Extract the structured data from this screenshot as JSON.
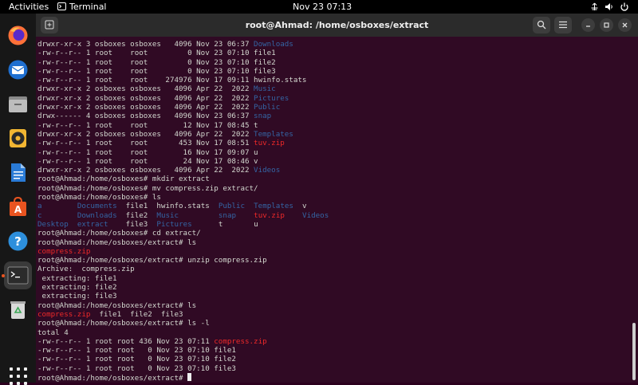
{
  "topbar": {
    "activities": "Activities",
    "app_name": "Terminal",
    "clock": "Nov 23  07:13"
  },
  "dock": {
    "items": [
      {
        "name": "firefox-icon"
      },
      {
        "name": "thunderbird-icon"
      },
      {
        "name": "files-icon"
      },
      {
        "name": "rhythmbox-icon"
      },
      {
        "name": "writer-icon"
      },
      {
        "name": "software-icon"
      },
      {
        "name": "help-icon"
      },
      {
        "name": "terminal-icon"
      },
      {
        "name": "trash-icon"
      },
      {
        "name": "show-apps-icon"
      }
    ]
  },
  "window": {
    "title": "root@Ahmad: /home/osboxes/extract"
  },
  "terminal": {
    "lines": [
      [
        {
          "t": "drwxr-xr-x 3 osboxes osboxes   4096 Nov 23 06:37 "
        },
        {
          "t": "Downloads",
          "c": "blue"
        }
      ],
      [
        {
          "t": "-rw-r--r-- 1 root    root         0 Nov 23 07:10 file1"
        }
      ],
      [
        {
          "t": "-rw-r--r-- 1 root    root         0 Nov 23 07:10 file2"
        }
      ],
      [
        {
          "t": "-rw-r--r-- 1 root    root         0 Nov 23 07:10 file3"
        }
      ],
      [
        {
          "t": "-rw-r--r-- 1 root    root    274976 Nov 17 09:11 hwinfo.stats"
        }
      ],
      [
        {
          "t": "drwxr-xr-x 2 osboxes osboxes   4096 Apr 22  2022 "
        },
        {
          "t": "Music",
          "c": "blue"
        }
      ],
      [
        {
          "t": "drwxr-xr-x 2 osboxes osboxes   4096 Apr 22  2022 "
        },
        {
          "t": "Pictures",
          "c": "blue"
        }
      ],
      [
        {
          "t": "drwxr-xr-x 2 osboxes osboxes   4096 Apr 22  2022 "
        },
        {
          "t": "Public",
          "c": "blue"
        }
      ],
      [
        {
          "t": "drwx------ 4 osboxes osboxes   4096 Nov 23 06:37 "
        },
        {
          "t": "snap",
          "c": "blue"
        }
      ],
      [
        {
          "t": "-rw-r--r-- 1 root    root        12 Nov 17 08:45 t"
        }
      ],
      [
        {
          "t": "drwxr-xr-x 2 osboxes osboxes   4096 Apr 22  2022 "
        },
        {
          "t": "Templates",
          "c": "blue"
        }
      ],
      [
        {
          "t": "-rw-r--r-- 1 root    root       453 Nov 17 08:51 "
        },
        {
          "t": "tuv.zip",
          "c": "red"
        }
      ],
      [
        {
          "t": "-rw-r--r-- 1 root    root        16 Nov 17 09:07 u"
        }
      ],
      [
        {
          "t": "-rw-r--r-- 1 root    root        24 Nov 17 08:46 v"
        }
      ],
      [
        {
          "t": "drwxr-xr-x 2 osboxes osboxes   4096 Apr 22  2022 "
        },
        {
          "t": "Videos",
          "c": "blue"
        }
      ],
      [
        {
          "t": "root@Ahmad:/home/osboxes# mkdir extract"
        }
      ],
      [
        {
          "t": "root@Ahmad:/home/osboxes# mv compress.zip extract/"
        }
      ],
      [
        {
          "t": "root@Ahmad:/home/osboxes# ls"
        }
      ],
      [
        {
          "t": "a",
          "c": "blue"
        },
        {
          "t": "        "
        },
        {
          "t": "Documents",
          "c": "blue"
        },
        {
          "t": "  file1  hwinfo.stats  "
        },
        {
          "t": "Public",
          "c": "blue"
        },
        {
          "t": "  "
        },
        {
          "t": "Templates",
          "c": "blue"
        },
        {
          "t": "  v"
        }
      ],
      [
        {
          "t": "c",
          "c": "blue"
        },
        {
          "t": "        "
        },
        {
          "t": "Downloads",
          "c": "blue"
        },
        {
          "t": "  file2  "
        },
        {
          "t": "Music",
          "c": "blue"
        },
        {
          "t": "         "
        },
        {
          "t": "snap",
          "c": "blue"
        },
        {
          "t": "    "
        },
        {
          "t": "tuv.zip",
          "c": "red"
        },
        {
          "t": "    "
        },
        {
          "t": "Videos",
          "c": "blue"
        }
      ],
      [
        {
          "t": "Desktop",
          "c": "blue"
        },
        {
          "t": "  "
        },
        {
          "t": "extract",
          "c": "blue"
        },
        {
          "t": "    file3  "
        },
        {
          "t": "Pictures",
          "c": "blue"
        },
        {
          "t": "      t       u"
        }
      ],
      [
        {
          "t": "root@Ahmad:/home/osboxes# cd extract/"
        }
      ],
      [
        {
          "t": "root@Ahmad:/home/osboxes/extract# ls"
        }
      ],
      [
        {
          "t": "compress.zip",
          "c": "red"
        }
      ],
      [
        {
          "t": "root@Ahmad:/home/osboxes/extract# unzip compress.zip"
        }
      ],
      [
        {
          "t": "Archive:  compress.zip"
        }
      ],
      [
        {
          "t": " extracting: file1"
        }
      ],
      [
        {
          "t": " extracting: file2"
        }
      ],
      [
        {
          "t": " extracting: file3"
        }
      ],
      [
        {
          "t": "root@Ahmad:/home/osboxes/extract# ls"
        }
      ],
      [
        {
          "t": "compress.zip",
          "c": "red"
        },
        {
          "t": "  file1  file2  file3"
        }
      ],
      [
        {
          "t": "root@Ahmad:/home/osboxes/extract# ls -l"
        }
      ],
      [
        {
          "t": "total 4"
        }
      ],
      [
        {
          "t": "-rw-r--r-- 1 root root 436 Nov 23 07:11 "
        },
        {
          "t": "compress.zip",
          "c": "red"
        }
      ],
      [
        {
          "t": "-rw-r--r-- 1 root root   0 Nov 23 07:10 file1"
        }
      ],
      [
        {
          "t": "-rw-r--r-- 1 root root   0 Nov 23 07:10 file2"
        }
      ],
      [
        {
          "t": "-rw-r--r-- 1 root root   0 Nov 23 07:10 file3"
        }
      ],
      [
        {
          "t": "root@Ahmad:/home/osboxes/extract# "
        },
        {
          "cursor": true
        }
      ]
    ]
  }
}
